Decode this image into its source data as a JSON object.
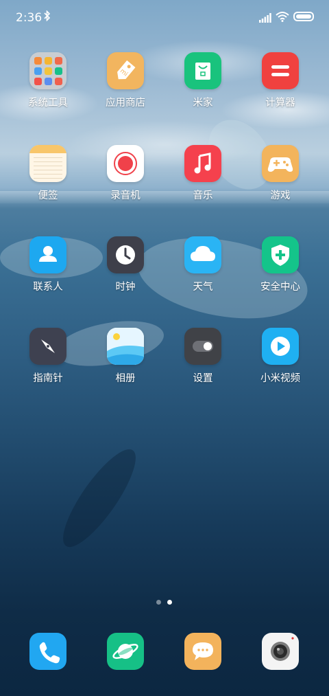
{
  "status_bar": {
    "time": "2:36",
    "bluetooth_icon": "bluetooth-icon",
    "signal_icon": "signal-icon",
    "wifi_icon": "wifi-icon",
    "battery_icon": "battery-icon"
  },
  "apps": [
    {
      "label": "系统工具",
      "icon": "folder-icon",
      "color": "#c9cdd2"
    },
    {
      "label": "应用商店",
      "icon": "price-tag-icon",
      "color": "#f2b55f"
    },
    {
      "label": "米家",
      "icon": "shopping-bag-icon",
      "color": "#19c37d"
    },
    {
      "label": "计算器",
      "icon": "equals-icon",
      "color": "#f0413f"
    },
    {
      "label": "便签",
      "icon": "notepad-icon",
      "color": "#fff6e6"
    },
    {
      "label": "录音机",
      "icon": "record-icon",
      "color": "#ffffff"
    },
    {
      "label": "音乐",
      "icon": "music-note-icon",
      "color": "#f5414d"
    },
    {
      "label": "游戏",
      "icon": "gamepad-icon",
      "color": "#f3b45c"
    },
    {
      "label": "联系人",
      "icon": "person-icon",
      "color": "#1da8f0"
    },
    {
      "label": "时钟",
      "icon": "clock-icon",
      "color": "#3e3f4a"
    },
    {
      "label": "天气",
      "icon": "cloud-icon",
      "color": "#2ab4f4"
    },
    {
      "label": "安全中心",
      "icon": "shield-icon",
      "color": "#14c48a"
    },
    {
      "label": "指南针",
      "icon": "compass-icon",
      "color": "#3e4150"
    },
    {
      "label": "相册",
      "icon": "gallery-icon",
      "color": "#ffffff"
    },
    {
      "label": "设置",
      "icon": "toggle-icon",
      "color": "#404247"
    },
    {
      "label": "小米视频",
      "icon": "play-icon",
      "color": "#1fb0f2"
    }
  ],
  "page_indicator": {
    "pages": 2,
    "current": 2
  },
  "dock": [
    {
      "icon": "phone-icon",
      "color": "#21a7f1"
    },
    {
      "icon": "browser-planet-icon",
      "color": "#16c086"
    },
    {
      "icon": "message-bubble-icon",
      "color": "#f3b35c"
    },
    {
      "icon": "camera-icon",
      "color": "#f4f4f4"
    }
  ]
}
